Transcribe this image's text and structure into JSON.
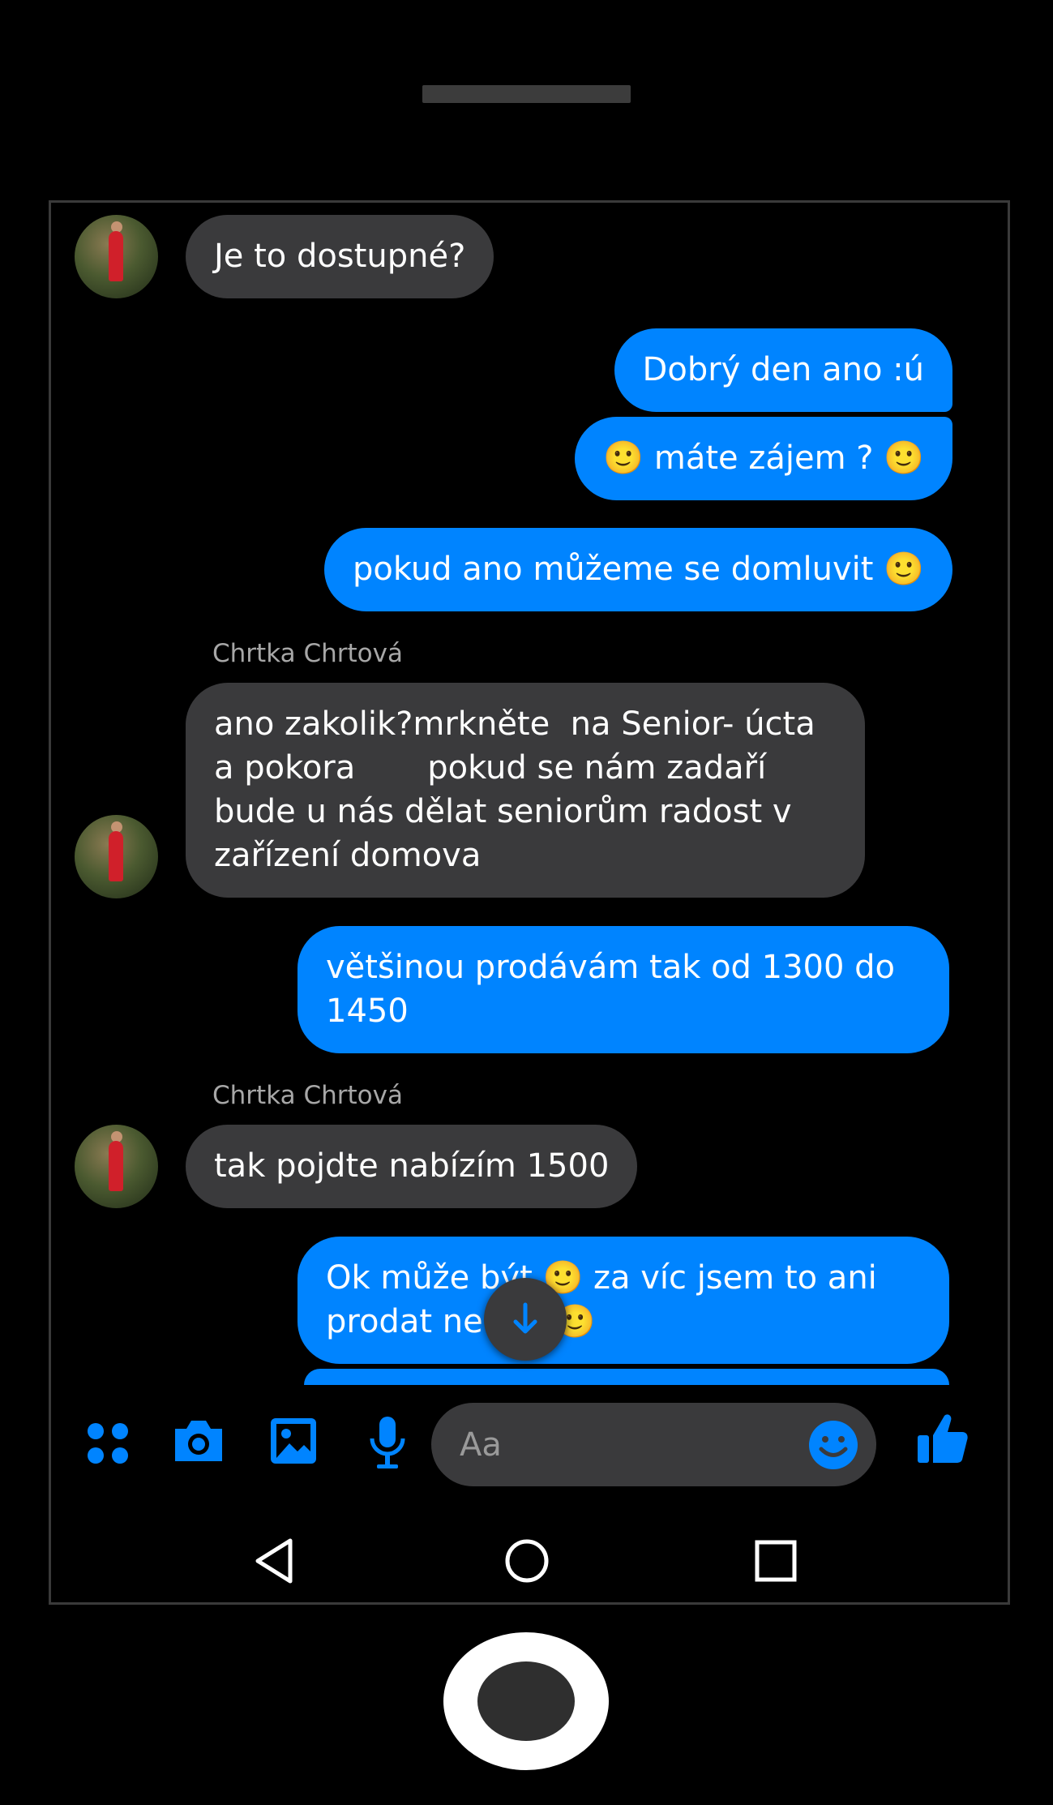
{
  "conversation": {
    "messages": [
      {
        "from": "them",
        "text": "Je to dostupné?"
      },
      {
        "from": "me",
        "text": "Dobrý den ano :ú"
      },
      {
        "from": "me",
        "text": "🙂 máte zájem ? 🙂"
      },
      {
        "from": "me",
        "text": "pokud ano můžeme se domluvit 🙂"
      },
      {
        "from": "them",
        "sender": "Chrtka Chrtová",
        "text": "ano zakolik?mrkněte  na Senior- úcta\na pokora       pokud se nám zadaří\nbude u nás dělat seniorům radost v\nzařízení domova"
      },
      {
        "from": "me",
        "text": "většinou prodávám tak od 1300 do\n1450"
      },
      {
        "from": "them",
        "sender": "Chrtka Chrtová",
        "text": "tak pojdte nabízím 1500"
      },
      {
        "from": "me",
        "text": "Ok může být 🙂 za víc jsem to ani\nprodat ne       🙂"
      }
    ]
  },
  "composer": {
    "placeholder": "Aa"
  },
  "icons": {
    "apps": "apps-grid-icon",
    "camera": "camera-icon",
    "gallery": "image-icon",
    "mic": "microphone-icon",
    "emoji": "emoji-icon",
    "like": "thumbs-up-icon",
    "scroll": "arrow-down-icon",
    "back": "nav-back-icon",
    "home": "nav-home-icon",
    "recents": "nav-recents-icon"
  },
  "colors": {
    "accent": "#0084ff",
    "incoming_bubble": "#3a3a3c",
    "background": "#000000"
  }
}
